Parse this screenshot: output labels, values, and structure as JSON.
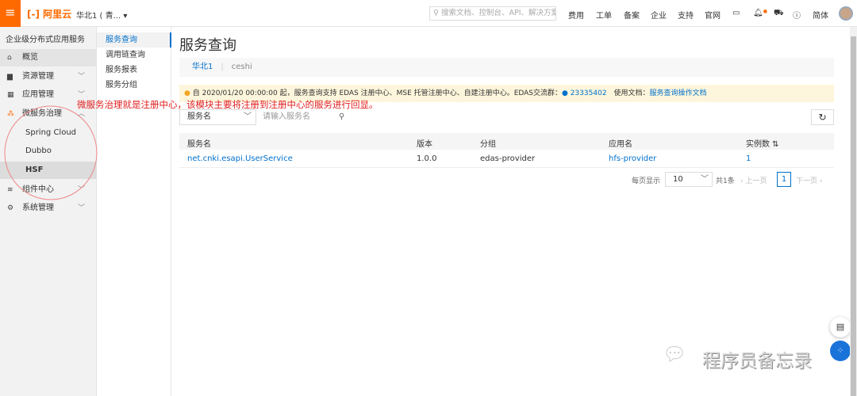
{
  "topbar": {
    "logo": "[-] 阿里云",
    "region": "华北1 ( 青... ▾",
    "search_placeholder": "搜索文档、控制台、API、解决方案",
    "nav": [
      "费用",
      "工单",
      "备案",
      "企业",
      "支持",
      "官网"
    ],
    "lang": "简体"
  },
  "sidebar": {
    "title": "企业级分布式应用服务",
    "items": [
      {
        "label": "概览",
        "icon": "home-icon"
      },
      {
        "label": "资源管理",
        "icon": "folder-icon"
      },
      {
        "label": "应用管理",
        "icon": "grid-icon"
      },
      {
        "label": "微服务治理",
        "icon": "cluster-icon"
      },
      {
        "label": "Spring Cloud"
      },
      {
        "label": "Dubbo"
      },
      {
        "label": "HSF"
      },
      {
        "label": "组件中心",
        "icon": "layers-icon"
      },
      {
        "label": "系统管理",
        "icon": "gear-icon"
      }
    ]
  },
  "submenu": [
    "服务查询",
    "调用链查询",
    "服务报表",
    "服务分组"
  ],
  "main": {
    "title": "服务查询",
    "breadcrumb": [
      "华北1",
      "ceshi"
    ],
    "notice": {
      "text": "自 2020/01/20 00:00:00 起，服务查询支持 EDAS 注册中心、MSE 托管注册中心、自建注册中心。EDAS交流群：",
      "group": "23335402",
      "doc_label": "使用文档：",
      "doc_link": "服务查询操作文档"
    },
    "annotation": "微服务治理就是注册中心，该模块主要将注册到注册中心的服务进行回显。",
    "filter": {
      "select": "服务名",
      "placeholder": "请输入服务名"
    },
    "table": {
      "headers": [
        "服务名",
        "版本",
        "分组",
        "应用名",
        "实例数"
      ],
      "rows": [
        [
          "net.cnki.esapi.UserService",
          "1.0.0",
          "edas-provider",
          "hfs-provider",
          "1"
        ]
      ]
    },
    "pagination": {
      "per_page_label": "每页显示",
      "per_page": "10",
      "total": "共1条",
      "prev": "上一页",
      "page": "1",
      "next": "下一页"
    }
  },
  "watermark": "程序员备忘录"
}
